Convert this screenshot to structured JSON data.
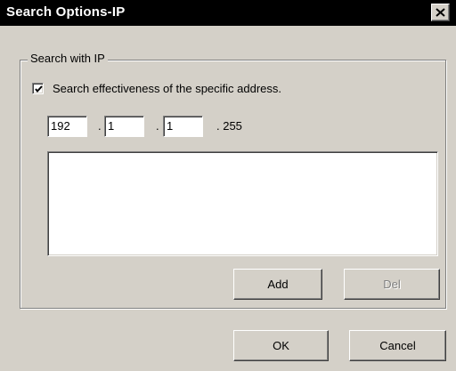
{
  "window": {
    "title": "Search Options-IP"
  },
  "group": {
    "label": "Search with IP"
  },
  "checkbox": {
    "label": "Search effectiveness of the specific address.",
    "checked": true
  },
  "ip": {
    "octet1": "192",
    "octet2": "1",
    "octet3": "1",
    "separator": ".",
    "octet4_label": ". 255"
  },
  "list": {
    "items": []
  },
  "buttons": {
    "add": "Add",
    "del": "Del",
    "ok": "OK",
    "cancel": "Cancel"
  },
  "icons": {
    "close": "close-icon",
    "check": "checkmark-icon"
  }
}
